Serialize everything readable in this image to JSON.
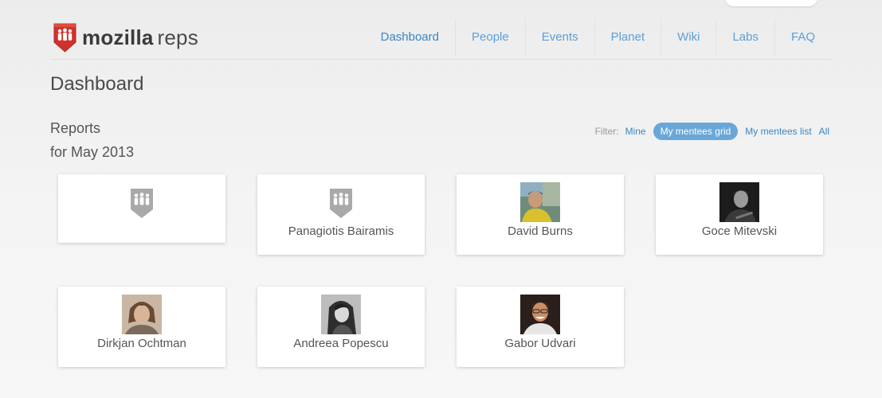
{
  "brand": {
    "name_bold": "mozilla",
    "name_light": "reps",
    "logo_icon": "mozilla-reps-shield-icon",
    "brand_color": "#d0322b"
  },
  "nav": {
    "items": [
      {
        "label": "Dashboard",
        "active": true
      },
      {
        "label": "People"
      },
      {
        "label": "Events"
      },
      {
        "label": "Planet"
      },
      {
        "label": "Wiki"
      },
      {
        "label": "Labs"
      },
      {
        "label": "FAQ"
      }
    ]
  },
  "page": {
    "title": "Dashboard"
  },
  "reports": {
    "heading_line1": "Reports",
    "heading_line2": "for May 2013"
  },
  "filter": {
    "label": "Filter:",
    "options": [
      {
        "label": "Mine"
      },
      {
        "label": "My mentees grid",
        "active": true
      },
      {
        "label": "My mentees list"
      },
      {
        "label": "All"
      }
    ]
  },
  "colors": {
    "link": "#3d86c5",
    "active_pill": "#6aa7d9",
    "placeholder_icon": "#a9a9a9"
  },
  "mentees": [
    {
      "name": "",
      "avatar": "placeholder-shield-icon"
    },
    {
      "name": "Panagiotis Bairamis",
      "avatar": "placeholder-shield-icon"
    },
    {
      "name": "David Burns",
      "avatar": "avatar-photo"
    },
    {
      "name": "Goce Mitevski",
      "avatar": "avatar-photo"
    },
    {
      "name": "Dirkjan Ochtman",
      "avatar": "avatar-photo"
    },
    {
      "name": "Andreea Popescu",
      "avatar": "avatar-photo"
    },
    {
      "name": "Gabor Udvari",
      "avatar": "avatar-photo"
    }
  ]
}
